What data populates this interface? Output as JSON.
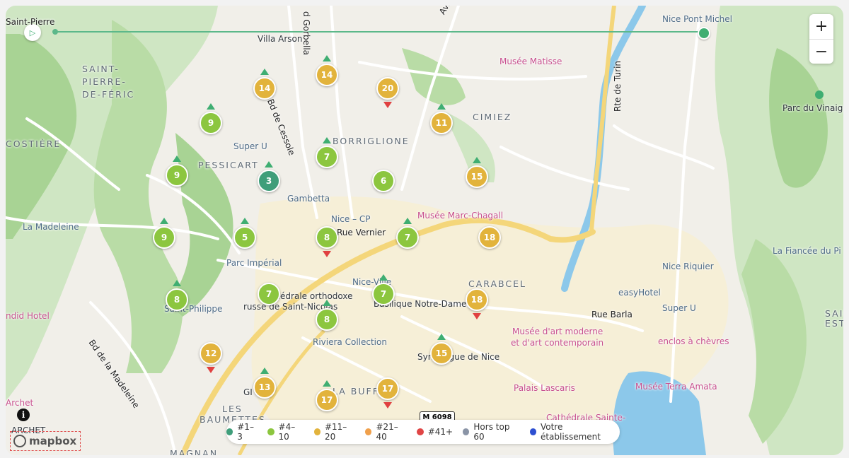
{
  "map": {
    "districts": [
      "SAINT-",
      "PIERRE-",
      "DE-FÉRIC",
      "PESSICART",
      "BORRIGLIONE",
      "CIMIEZ",
      "CARABCEL",
      "LES",
      "BAUMETTES",
      "MAGNAN",
      "LA BUFF",
      "COSTIÈRE",
      "SAIN",
      "ESTÈ"
    ],
    "places": [
      "Nice Pont Michel",
      "Villa Arson",
      "Musée Matisse",
      "Parc du Vinaigrier",
      "Super U",
      "La Madeleine",
      "Gambetta",
      "Nice – CP",
      "Rue Vernier",
      "Musée Marc-Chagall",
      "Parc Impérial",
      "Nice-Ville",
      "Cathédrale orthodoxe",
      "russe de Saint-Nicolas",
      "Basilique Notre-Dame",
      "Saint-Philippe",
      "Riviera Collection",
      "Synagogue de Nice",
      "Musée d'art moderne",
      "et d'art contemporain",
      "Nice Riquier",
      "easyHotel",
      "Super U",
      "Rue Barla",
      "enclos à chèvres",
      "La Fiancée du Pi",
      "Palais Lascaris",
      "Musée Terra Amata",
      "Cathédrale Sainte-",
      "Bd de Cessole",
      "Bd de la Madeleine",
      "Rte de Turin",
      "Av. de",
      "d Gorbella",
      "Saint-Pierre",
      "ndid Hotel",
      "Archet",
      "ARCHET",
      "GI   SO"
    ],
    "shield": "M 6098"
  },
  "markers": [
    {
      "label": "14",
      "rank": "#11–20",
      "trend": "up"
    },
    {
      "label": "20",
      "rank": "#11–20",
      "trend": "down"
    },
    {
      "label": "14",
      "rank": "#11–20",
      "trend": "up"
    },
    {
      "label": "9",
      "rank": "#4–10",
      "trend": "up"
    },
    {
      "label": "11",
      "rank": "#11–20",
      "trend": "up"
    },
    {
      "label": "7",
      "rank": "#4–10",
      "trend": "up"
    },
    {
      "label": "9",
      "rank": "#4–10",
      "trend": "up"
    },
    {
      "label": "3",
      "rank": "#1–3",
      "trend": "up"
    },
    {
      "label": "6",
      "rank": "#4–10",
      "trend": "none"
    },
    {
      "label": "15",
      "rank": "#11–20",
      "trend": "up"
    },
    {
      "label": "9",
      "rank": "#4–10",
      "trend": "up"
    },
    {
      "label": "5",
      "rank": "#4–10",
      "trend": "up"
    },
    {
      "label": "8",
      "rank": "#4–10",
      "trend": "down"
    },
    {
      "label": "7",
      "rank": "#4–10",
      "trend": "up"
    },
    {
      "label": "18",
      "rank": "#11–20",
      "trend": "none"
    },
    {
      "label": "8",
      "rank": "#4–10",
      "trend": "up"
    },
    {
      "label": "7",
      "rank": "#4–10",
      "trend": "none"
    },
    {
      "label": "7",
      "rank": "#4–10",
      "trend": "up"
    },
    {
      "label": "18",
      "rank": "#11–20",
      "trend": "down"
    },
    {
      "label": "8",
      "rank": "#4–10",
      "trend": "up"
    },
    {
      "label": "12",
      "rank": "#11–20",
      "trend": "down"
    },
    {
      "label": "15",
      "rank": "#11–20",
      "trend": "up"
    },
    {
      "label": "13",
      "rank": "#11–20",
      "trend": "up"
    },
    {
      "label": "17",
      "rank": "#11–20",
      "trend": "up"
    },
    {
      "label": "17",
      "rank": "#11–20",
      "trend": "down"
    }
  ],
  "legend": [
    {
      "label": "#1–3",
      "color": "#3f9e7a"
    },
    {
      "label": "#4–10",
      "color": "#8cc63f"
    },
    {
      "label": "#11–20",
      "color": "#e2b33c"
    },
    {
      "label": "#21–40",
      "color": "#f0a04b"
    },
    {
      "label": "#41+",
      "color": "#e04545"
    },
    {
      "label": "Hors top 60",
      "color": "#8a94a6"
    },
    {
      "label": "Votre établissement",
      "color": "#2d4fd1"
    }
  ],
  "controls": {
    "zoom_in": "+",
    "zoom_out": "−",
    "play": "▷",
    "info": "i",
    "attribution": "mapbox"
  },
  "colors": {
    "rank_1_3": "#3f9e7a",
    "rank_4_10": "#8cc63f",
    "rank_11_20": "#e2b33c",
    "trend_up": "#3fae72",
    "trend_down": "#e04040"
  }
}
